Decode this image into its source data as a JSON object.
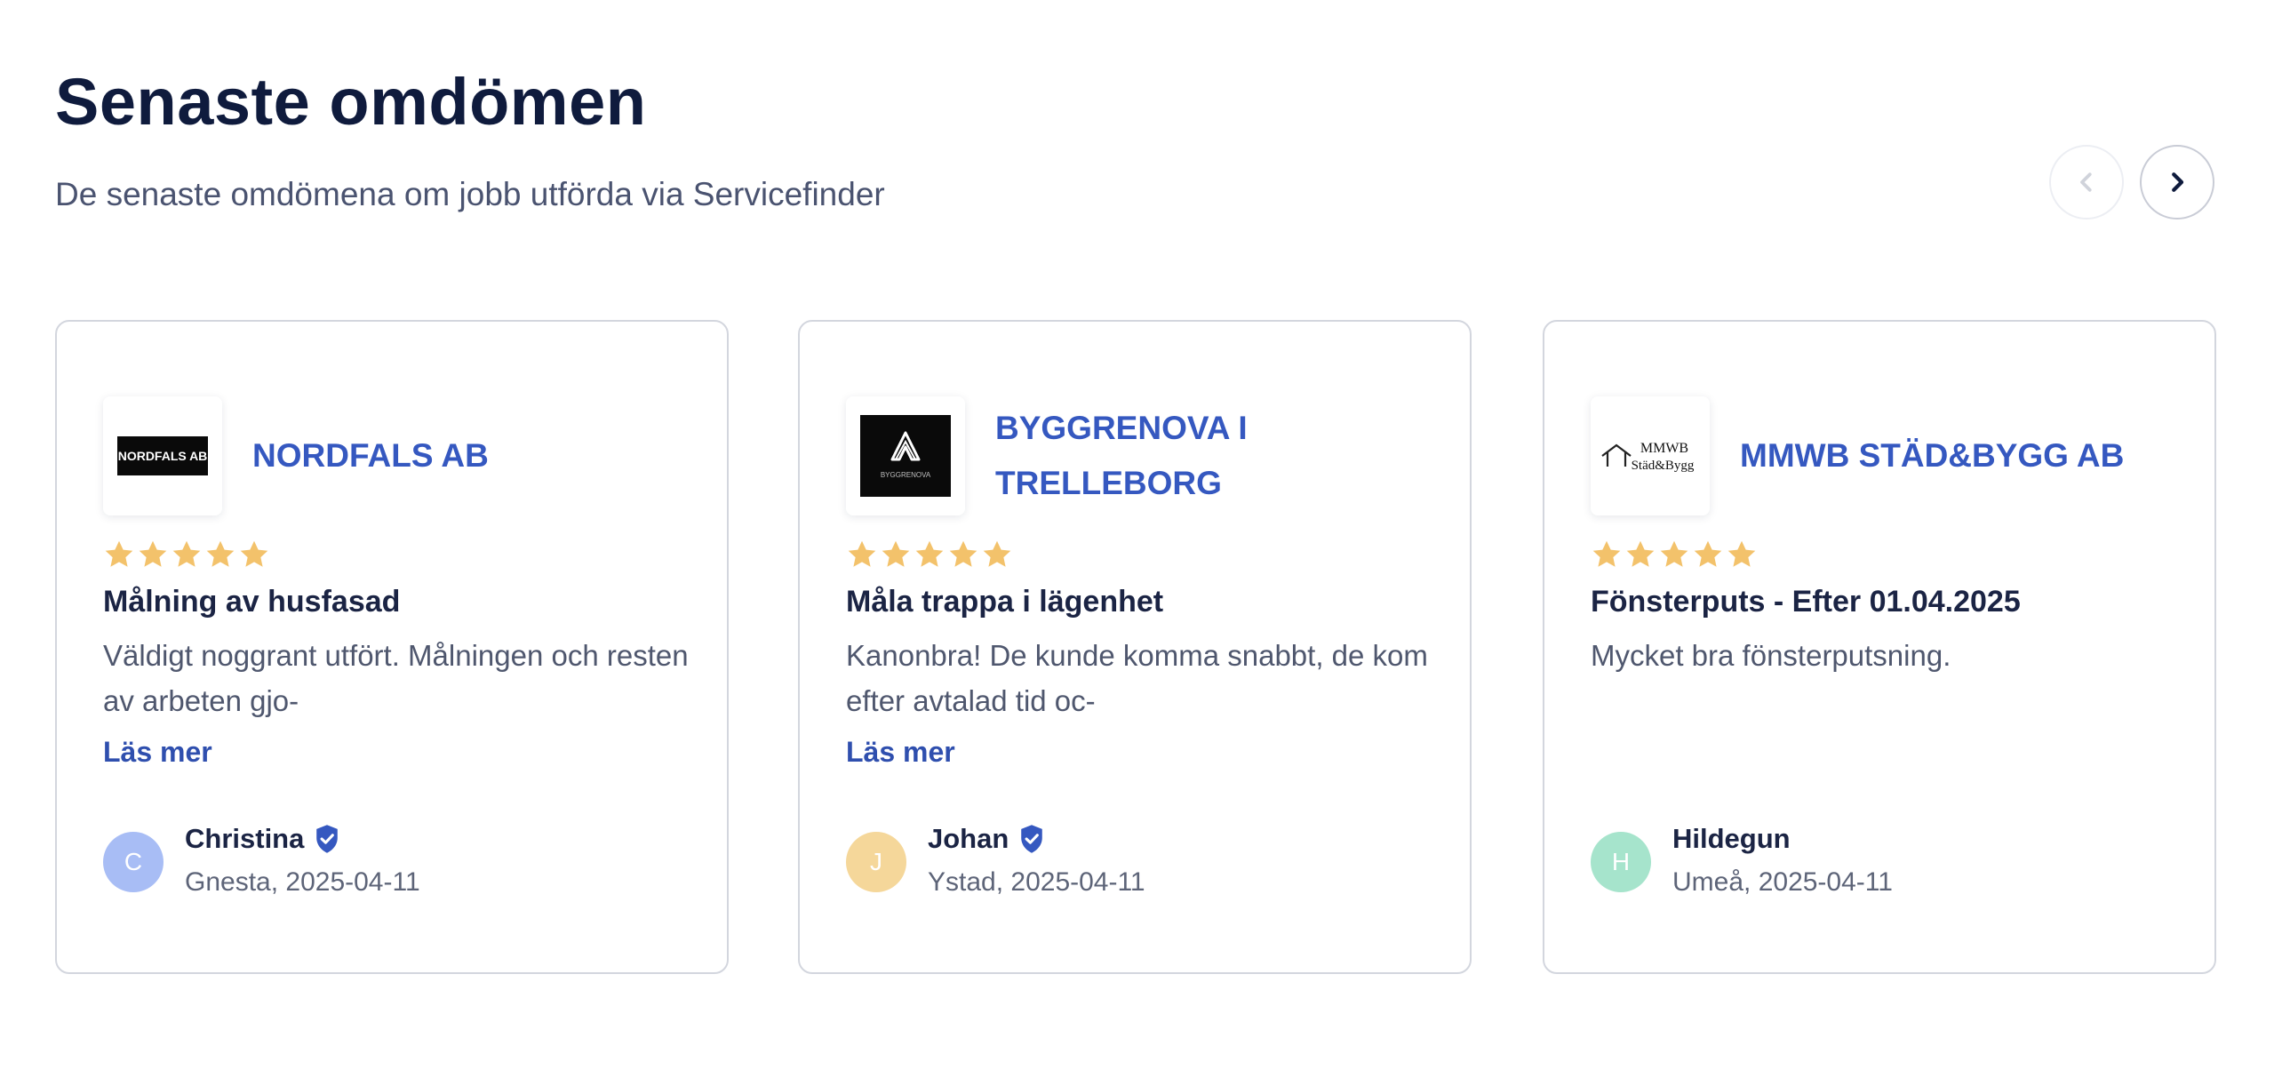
{
  "header": {
    "title": "Senaste omdömen",
    "subtitle": "De senaste omdömena om jobb utförda via Servicefinder"
  },
  "nav": {
    "prev_icon": "chevron-left-icon",
    "next_icon": "chevron-right-icon"
  },
  "colors": {
    "star": "#f3c26b",
    "company": "#3558c0",
    "verified": "#3558c0",
    "avatar_c": "#a8bdf5",
    "avatar_j": "#f5d79a",
    "avatar_h": "#a6e4cc"
  },
  "reviews": [
    {
      "logo": {
        "text": "NORDFALS AB"
      },
      "company": "NORDFALS AB",
      "rating": 5,
      "title": "Målning av husfasad",
      "text": "Väldigt noggrant utfört. Målningen och resten av arbeten gjo-",
      "read_more": "Läs mer",
      "avatar_initial": "C",
      "reviewer": "Christina",
      "verified": true,
      "meta": "Gnesta, 2025-04-11"
    },
    {
      "logo": {
        "text": "BYGGRENOVA"
      },
      "company": "BYGGRENOVA I TRELLEBORG",
      "rating": 5,
      "title": "Måla trappa i lägenhet",
      "text": "Kanonbra! De kunde komma snabbt, de kom efter avtalad tid oc-",
      "read_more": "Läs mer",
      "avatar_initial": "J",
      "reviewer": "Johan",
      "verified": true,
      "meta": "Ystad, 2025-04-11"
    },
    {
      "logo": {
        "line1": "MMWB",
        "line2": "Städ&Bygg"
      },
      "company": "MMWB STÄD&BYGG AB",
      "rating": 5,
      "title": "Fönsterputs - Efter 01.04.2025",
      "text": "Mycket bra fönsterputsning.",
      "avatar_initial": "H",
      "reviewer": "Hildegun",
      "verified": false,
      "meta": "Umeå, 2025-04-11"
    }
  ]
}
